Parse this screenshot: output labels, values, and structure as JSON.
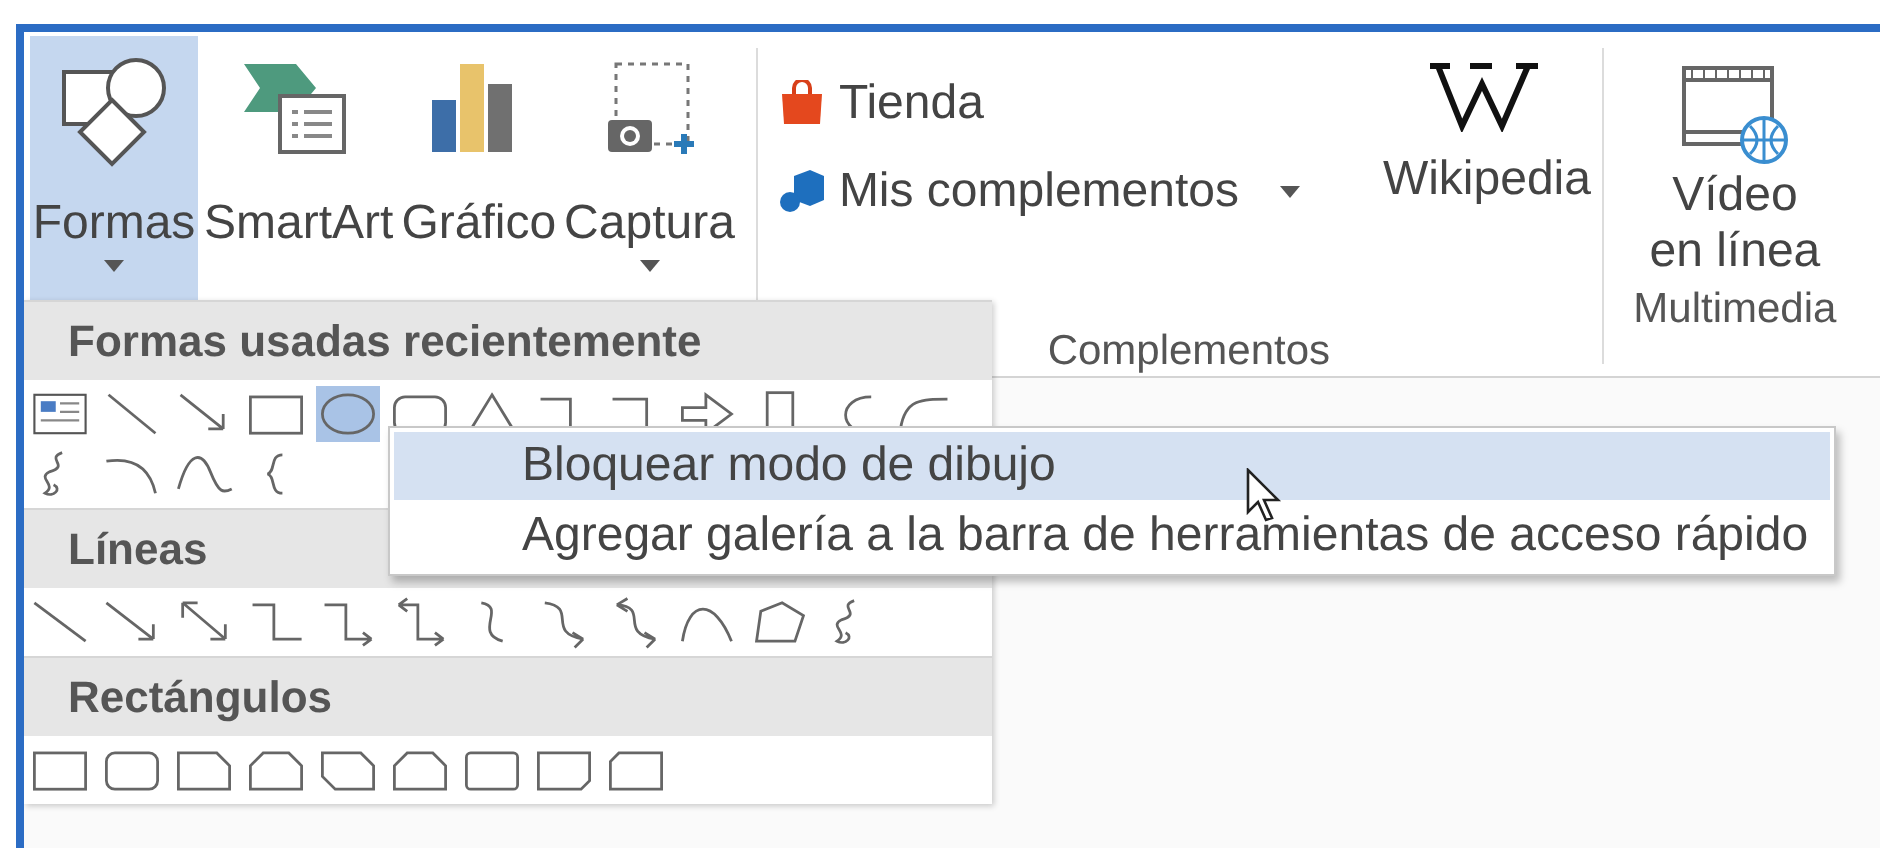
{
  "ribbon": {
    "buttons": [
      {
        "label": "Formas",
        "pressed": true,
        "dropdown": true
      },
      {
        "label": "SmartArt",
        "pressed": false,
        "dropdown": false
      },
      {
        "label": "Gráfico",
        "pressed": false,
        "dropdown": false
      },
      {
        "label": "Captura",
        "pressed": false,
        "dropdown": true
      }
    ],
    "addins": {
      "store": "Tienda",
      "my_addins": "Mis complementos",
      "wikipedia": "Wikipedia",
      "group_label": "Complementos"
    },
    "media": {
      "lines": [
        "Vídeo",
        "en línea"
      ],
      "group_label": "Multimedia"
    }
  },
  "shapes_menu": {
    "sections": [
      {
        "kind": "recent",
        "title": "Formas usadas recientemente",
        "shapes": [
          {
            "selected": false
          },
          {
            "selected": false
          },
          {
            "selected": false
          },
          {
            "selected": false
          },
          {
            "selected": true
          },
          {
            "selected": false
          },
          {
            "selected": false
          },
          {
            "selected": false
          },
          {
            "selected": false
          },
          {
            "selected": false
          },
          {
            "selected": false
          },
          {
            "selected": false
          },
          {
            "selected": false
          },
          {
            "selected": false
          },
          {
            "selected": false
          },
          {
            "selected": false
          },
          {
            "selected": false
          }
        ]
      },
      {
        "kind": "lines",
        "title": "Líneas",
        "shapes": [
          {
            "selected": false
          },
          {
            "selected": false
          },
          {
            "selected": false
          },
          {
            "selected": false
          },
          {
            "selected": false
          },
          {
            "selected": false
          },
          {
            "selected": false
          },
          {
            "selected": false
          },
          {
            "selected": false
          },
          {
            "selected": false
          },
          {
            "selected": false
          },
          {
            "selected": false
          }
        ]
      },
      {
        "kind": "rectangles",
        "title": "Rectángulos",
        "shapes": [
          {
            "selected": false
          },
          {
            "selected": false
          },
          {
            "selected": false
          },
          {
            "selected": false
          },
          {
            "selected": false
          },
          {
            "selected": false
          },
          {
            "selected": false
          },
          {
            "selected": false
          },
          {
            "selected": false
          }
        ]
      }
    ]
  },
  "context_menu": {
    "items": [
      {
        "label": "Bloquear modo de dibujo",
        "selected": true
      },
      {
        "label": "Agregar galería a la barra de herramientas de acceso rápido",
        "selected": false
      }
    ]
  }
}
